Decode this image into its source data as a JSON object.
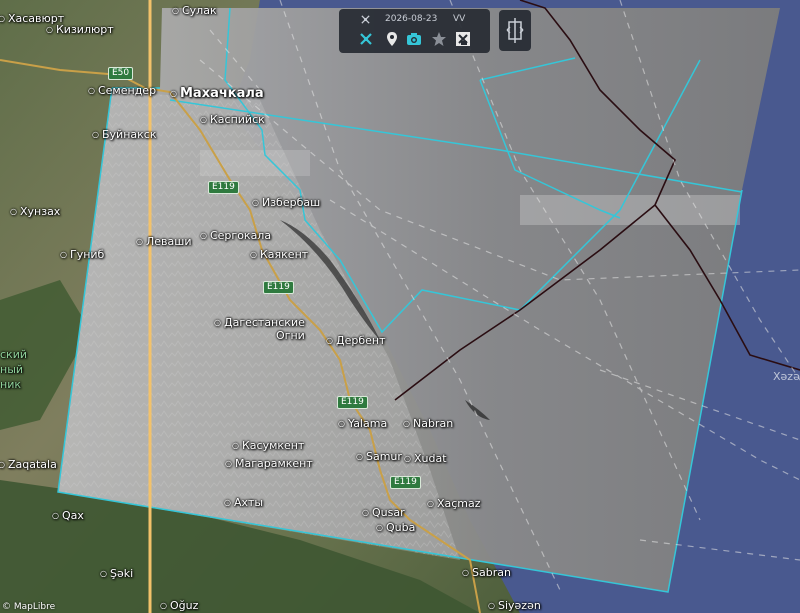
{
  "toolbar": {
    "date": "2026-08-23",
    "mode": "VV",
    "icons": [
      "satellite-icon",
      "tools-icon",
      "location-pin-icon",
      "camera-icon",
      "star-icon",
      "sar-layer-icon"
    ],
    "accent": "#35c6d8"
  },
  "side_button": {
    "icon": "split-compare-icon"
  },
  "labels": {
    "sulak": "Сулак",
    "kasavyurt": "Хасавюрт",
    "kizilyurt": "Кизилюрт",
    "semender": "Семендер",
    "makhachkala": "Махачкала",
    "kaspiysk": "Каспийск",
    "buynaksk": "Буйнакск",
    "khunzakh": "Хунзах",
    "levashi": "Леваши",
    "gunib": "Гуниб",
    "izberbash": "Избербаш",
    "sergokala": "Сергокала",
    "kayakent": "Каякент",
    "dag_ogni_1": "Дагестанские",
    "dag_ogni_2": "Огни",
    "derbent": "Дербент",
    "yalama": "Yalama",
    "nabran": "Nabran",
    "kasumkent": "Касумкент",
    "magaramkent": "Магарамкент",
    "samur": "Samur",
    "xudat": "Xudat",
    "akhty": "Ахты",
    "zaqatala": "Zaqatala",
    "qax": "Qax",
    "xacmaz": "Xaçmaz",
    "qusar": "Qusar",
    "quba": "Quba",
    "seki": "Şəki",
    "oguz": "Oğuz",
    "sabran": "Sabran",
    "siyazen": "Siyəzən",
    "xezer": "Xəzə",
    "reserve_1": "ский",
    "reserve_2": "ный",
    "reserve_3": "ник"
  },
  "roads": {
    "e50": "E50",
    "e119_1": "E119",
    "e119_2": "E119",
    "e119_3": "E119",
    "e119_4": "E119"
  },
  "attribution": "© MapLibre",
  "colors": {
    "footprint": "#35c6d8",
    "sea": "#49598f",
    "date_line": "#f3c26a",
    "border": "#2a0d12"
  }
}
